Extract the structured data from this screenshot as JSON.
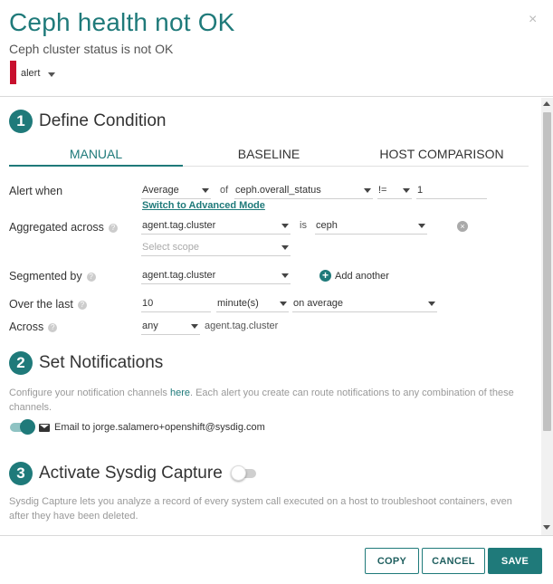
{
  "header": {
    "title": "Ceph health not OK",
    "subtitle": "Ceph cluster status is not OK",
    "severity_label": "alert",
    "severity_color": "#c8102e",
    "close_glyph": "×"
  },
  "section1": {
    "number": "1",
    "title": "Define Condition",
    "tabs": [
      {
        "label": "MANUAL",
        "active": true
      },
      {
        "label": "BASELINE",
        "active": false
      },
      {
        "label": "HOST COMPARISON",
        "active": false
      }
    ],
    "alert_when": {
      "label": "Alert when",
      "aggregation": "Average",
      "of_text": "of",
      "metric": "ceph.overall_status",
      "operator": "!=",
      "threshold": "1",
      "advanced_link": "Switch to Advanced Mode"
    },
    "aggregated_across": {
      "label": "Aggregated across",
      "tag": "agent.tag.cluster",
      "is_text": "is",
      "value": "ceph",
      "scope_placeholder": "Select scope"
    },
    "segmented_by": {
      "label": "Segmented by",
      "tag": "agent.tag.cluster",
      "add_label": "Add another"
    },
    "over_the_last": {
      "label": "Over the last",
      "amount": "10",
      "unit": "minute(s)",
      "mode": "on average"
    },
    "across": {
      "label": "Across",
      "quantifier": "any",
      "tag_text": "agent.tag.cluster"
    }
  },
  "section2": {
    "number": "2",
    "title": "Set Notifications",
    "description_before": "Configure your notification channels ",
    "description_link": "here",
    "description_after": ". Each alert you create can route notifications to any combination of these channels.",
    "email_label": "Email to jorge.salamero+openshift@sysdig.com",
    "email_enabled": true
  },
  "section3": {
    "number": "3",
    "title": "Activate Sysdig Capture",
    "capture_enabled": false,
    "description": "Sysdig Capture lets you analyze a record of every system call executed on a host to troubleshoot containers, even after they have been deleted."
  },
  "footer": {
    "copy_label": "COPY",
    "cancel_label": "CANCEL",
    "save_label": "SAVE"
  },
  "colors": {
    "accent": "#1f7a7a"
  }
}
